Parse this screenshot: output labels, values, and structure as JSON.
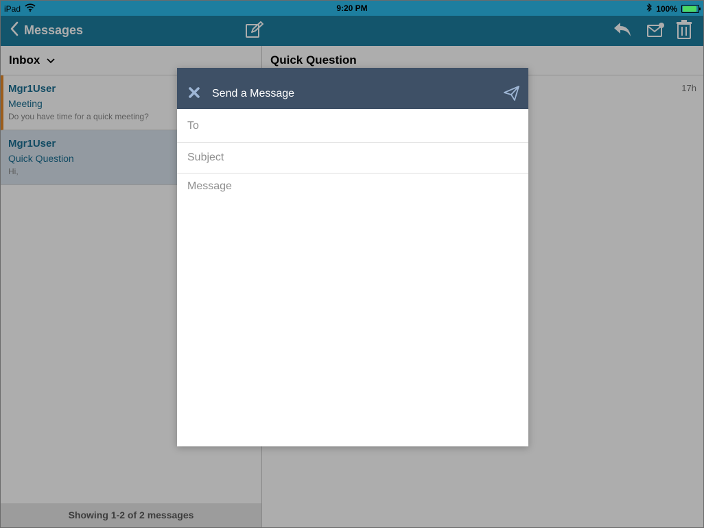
{
  "status": {
    "device": "iPad",
    "time": "9:20 PM",
    "battery": "100%"
  },
  "nav": {
    "back_label": "Messages"
  },
  "inbox": {
    "label": "Inbox",
    "messages": [
      {
        "from": "Mgr1User",
        "subject": "Meeting",
        "preview": "Do you have time for a quick meeting?"
      },
      {
        "from": "Mgr1User",
        "subject": "Quick Question",
        "preview": "Hi,"
      }
    ],
    "footer": "Showing 1-2 of 2 messages"
  },
  "detail": {
    "title": "Quick Question",
    "time": "17h"
  },
  "modal": {
    "title": "Send a Message",
    "to_placeholder": "To",
    "subject_placeholder": "Subject",
    "message_placeholder": "Message"
  },
  "colors": {
    "navbar": "#1d7e9f",
    "modal_header": "#3e5066",
    "unread_accent": "#e58a2a",
    "link_text": "#1b6f93"
  },
  "icons": [
    "wifi-icon",
    "bluetooth-icon",
    "battery-icon",
    "chevron-left-icon",
    "compose-icon",
    "reply-icon",
    "mail-icon",
    "trash-icon",
    "chevron-down-icon",
    "close-icon",
    "send-icon"
  ]
}
